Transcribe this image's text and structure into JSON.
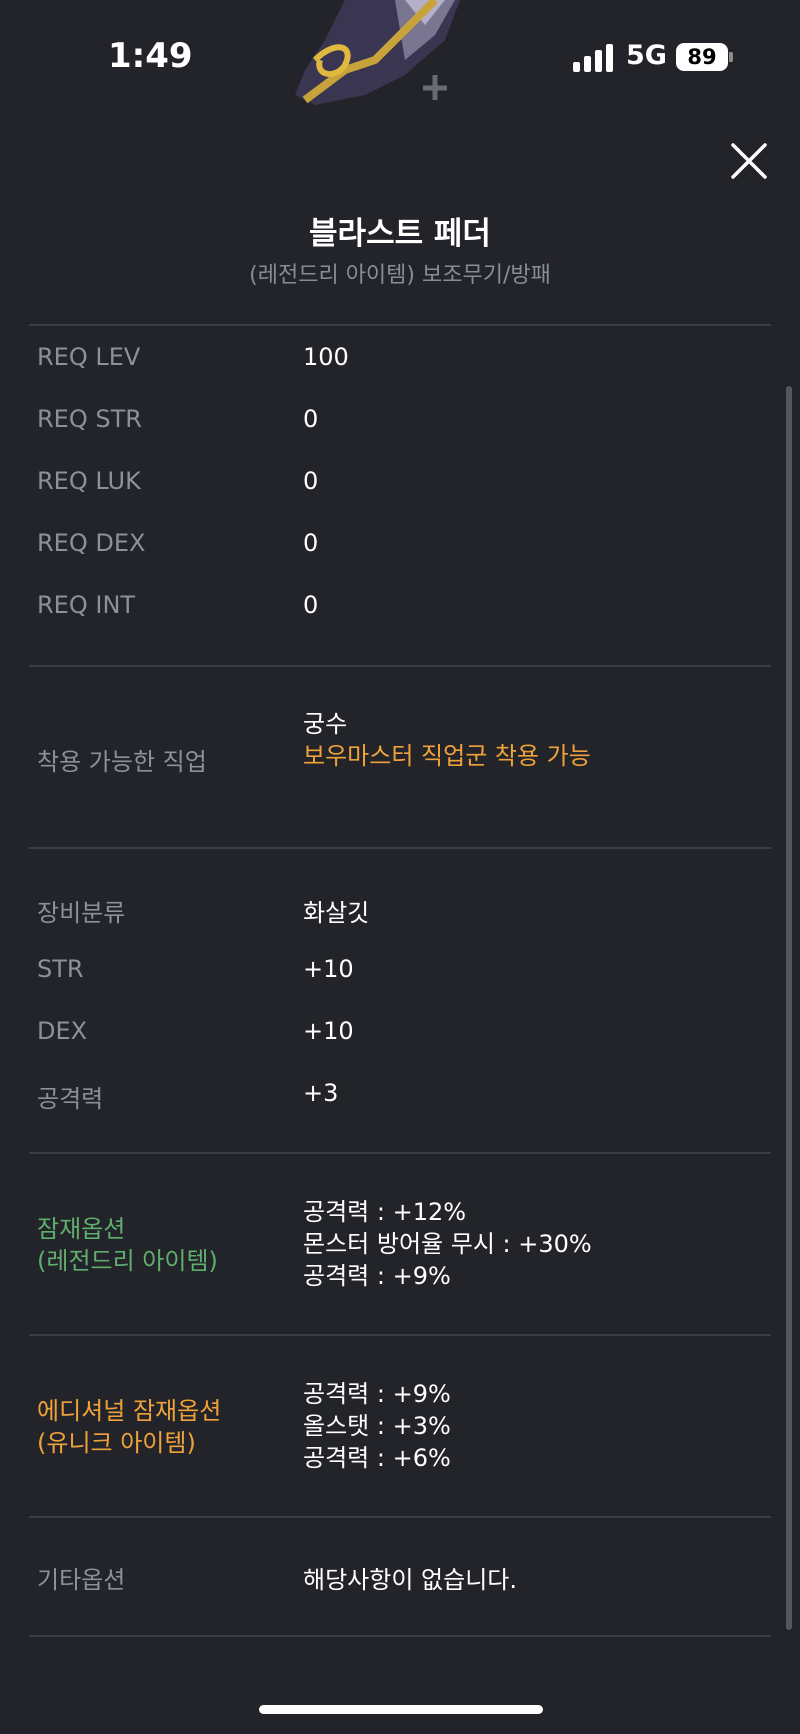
{
  "status": {
    "time": "1:49",
    "network": "5G",
    "battery": "89"
  },
  "item": {
    "name": "블라스트 페더",
    "subtitle": "(레전드리 아이템) 보조무기/방패"
  },
  "requirements": [
    {
      "label": "REQ LEV",
      "value": "100"
    },
    {
      "label": "REQ STR",
      "value": "0"
    },
    {
      "label": "REQ LUK",
      "value": "0"
    },
    {
      "label": "REQ DEX",
      "value": "0"
    },
    {
      "label": "REQ INT",
      "value": "0"
    }
  ],
  "job": {
    "label": "착용 가능한 직업",
    "value": "궁수",
    "note": "보우마스터 직업군 착용 가능"
  },
  "stats": [
    {
      "label": "장비분류",
      "value": "화살깃"
    },
    {
      "label": "STR",
      "value": "+10"
    },
    {
      "label": "DEX",
      "value": "+10"
    },
    {
      "label": "공격력",
      "value": "+3"
    }
  ],
  "potential": {
    "label_line1": "잠재옵션",
    "label_line2": "(레전드리 아이템)",
    "lines": [
      "공격력 : +12%",
      "몬스터 방어율 무시 : +30%",
      "공격력 : +9%"
    ]
  },
  "additional": {
    "label_line1": "에디셔널 잠재옵션",
    "label_line2": "(유니크 아이템)",
    "lines": [
      "공격력 : +9%",
      "올스탯 : +3%",
      "공격력 : +6%"
    ]
  },
  "etc": {
    "label": "기타옵션",
    "value": "해당사항이 없습니다."
  },
  "colors": {
    "background": "#232429",
    "legendary_green": "#5fae6e",
    "unique_orange": "#f0a23a",
    "label_gray": "#8e9099"
  },
  "icons": {
    "close": "close-x-icon",
    "signal": "cellular-signal-icon",
    "battery": "battery-icon",
    "item": "feather-weapon-icon"
  }
}
